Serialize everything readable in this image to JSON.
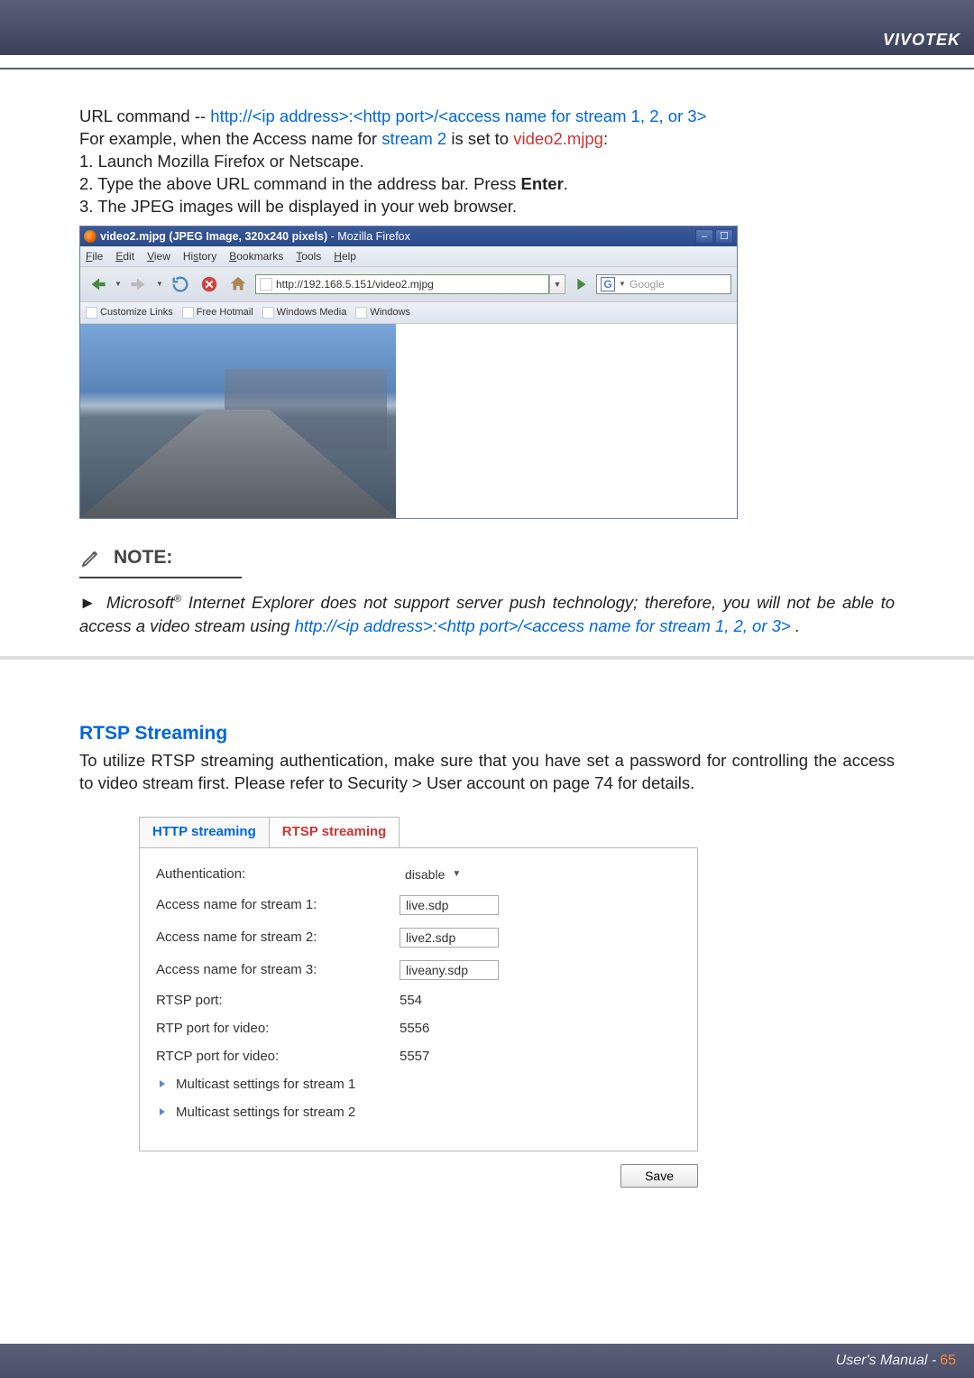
{
  "header": {
    "brand": "VIVOTEK"
  },
  "url_section": {
    "line1_prefix": "URL command -- ",
    "line1_url": "http://<ip address>:<http port>/<access name for stream 1, 2, or 3>",
    "line2_a": "For example, when the Access name for ",
    "line2_b": "stream 2",
    "line2_c": " is set to ",
    "line2_d": "video2.mjpg",
    "line2_e": ":",
    "step1": "1. Launch Mozilla Firefox or Netscape.",
    "step2a": "2. Type the above URL command in the address bar. Press ",
    "step2b": "Enter",
    "step2c": ".",
    "step3": "3. The JPEG images will be displayed in your web browser."
  },
  "browser": {
    "title_main": "video2.mjpg (JPEG Image, 320x240 pixels)",
    "title_suffix": " - Mozilla Firefox",
    "menus": {
      "file": "File",
      "edit": "Edit",
      "view": "View",
      "history": "History",
      "bookmarks": "Bookmarks",
      "tools": "Tools",
      "help": "Help"
    },
    "address": "http://192.168.5.151/video2.mjpg",
    "search_engine": "G",
    "search_placeholder": "Google",
    "bookmarks": {
      "b1": "Customize Links",
      "b2": "Free Hotmail",
      "b3": "Windows Media",
      "b4": "Windows"
    }
  },
  "note": {
    "heading": "NOTE:",
    "arrow": "►",
    "text1a": "Microsoft",
    "text1sup": "®",
    "text1b": " Internet Explorer does not support server push technology; therefore, you will not be able to access a video stream using ",
    "text1c": "http://<ip address>:<http port>/<access name for stream 1, 2, or 3>",
    "text1d": " ."
  },
  "rtsp": {
    "title": "RTSP Streaming",
    "body": "To utilize RTSP streaming authentication, make sure that you have set a password for controlling the access to video stream first. Please refer to Security > User account on page 74 for details.",
    "tabs": {
      "http": "HTTP streaming",
      "rtsp": "RTSP streaming"
    },
    "fields": {
      "auth_label": "Authentication:",
      "auth_val": "disable",
      "s1_label": "Access name for stream 1:",
      "s1_val": "live.sdp",
      "s2_label": "Access name for stream 2:",
      "s2_val": "live2.sdp",
      "s3_label": "Access name for stream 3:",
      "s3_val": "liveany.sdp",
      "rtsp_port_label": "RTSP port:",
      "rtsp_port_val": "554",
      "rtp_port_label": "RTP port for video:",
      "rtp_port_val": "5556",
      "rtcp_port_label": "RTCP port for video:",
      "rtcp_port_val": "5557",
      "mc1": "Multicast settings for stream 1",
      "mc2": "Multicast settings for stream 2"
    },
    "save": "Save"
  },
  "footer": {
    "text": "User's Manual - ",
    "page": "65"
  }
}
